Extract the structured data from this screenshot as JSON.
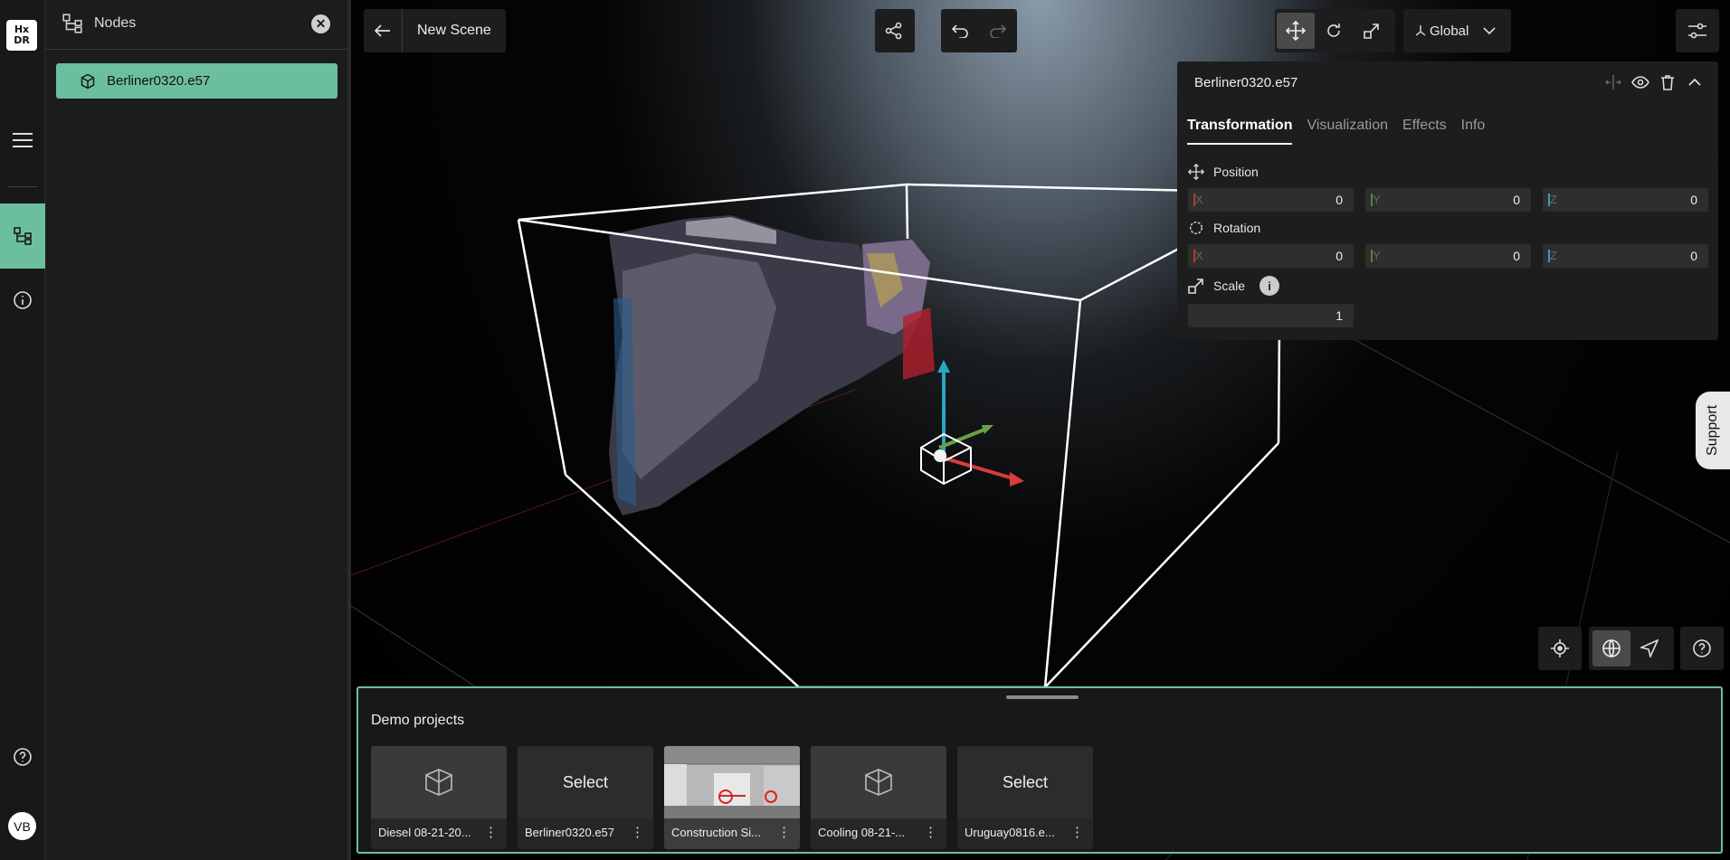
{
  "rail": {
    "logo_line1": "Hx",
    "logo_line2": "DR",
    "avatar_initials": "VB",
    "icons": [
      "menu-icon",
      "nodes-tree-icon",
      "info-icon",
      "help-icon"
    ]
  },
  "nodes_panel": {
    "title": "Nodes",
    "items": [
      {
        "label": "Berliner0320.e57",
        "icon": "cube-icon"
      }
    ]
  },
  "toolbar": {
    "scene_name": "New Scene",
    "coord_space": "Global",
    "active_tool": "move"
  },
  "properties": {
    "title": "Berliner0320.e57",
    "tabs": [
      "Transformation",
      "Visualization",
      "Effects",
      "Info"
    ],
    "active_tab": "Transformation",
    "position": {
      "label": "Position",
      "x_label": "X",
      "y_label": "Y",
      "z_label": "Z",
      "x": "0",
      "y": "0",
      "z": "0"
    },
    "rotation": {
      "label": "Rotation",
      "x_label": "X",
      "y_label": "Y",
      "z_label": "Z",
      "x": "0",
      "y": "0",
      "z": "0"
    },
    "scale": {
      "label": "Scale",
      "value": "1",
      "info_glyph": "i"
    },
    "axis_colors": {
      "x": "#c0392b",
      "y": "#4d8a3a",
      "z": "#3aa0b8"
    }
  },
  "support_label": "Support",
  "demo": {
    "title": "Demo projects",
    "cards": [
      {
        "name": "Diesel 08-21-20...",
        "thumb": "placeholder"
      },
      {
        "name": "Berliner0320.e57",
        "thumb": "select",
        "thumb_label": "Select"
      },
      {
        "name": "Construction Si...",
        "thumb": "photo"
      },
      {
        "name": "Cooling 08-21-...",
        "thumb": "placeholder"
      },
      {
        "name": "Uruguay0816.e...",
        "thumb": "select",
        "thumb_label": "Select"
      }
    ]
  },
  "colors": {
    "accent": "#6bbf9f",
    "panel": "#1d1d1d"
  }
}
